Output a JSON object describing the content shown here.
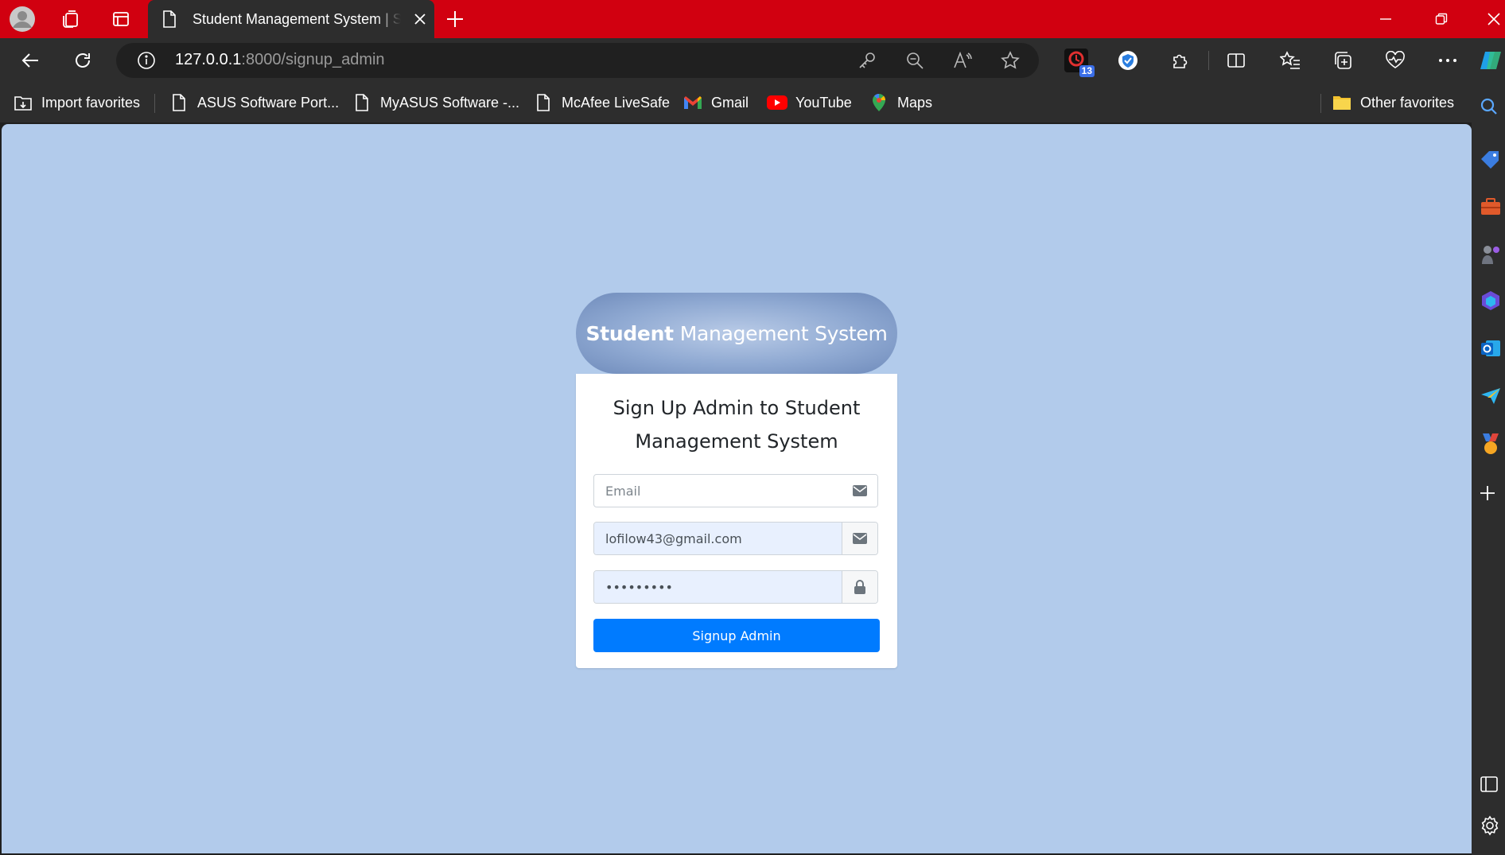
{
  "browser": {
    "tab": {
      "title": "Student Management System | Si"
    },
    "address": {
      "host": "127.0.0.1",
      "rest": ":8000/signup_admin"
    },
    "extension_badge": "13",
    "favorites": [
      {
        "label": "Import favorites",
        "icon": "import-icon"
      },
      {
        "label": "ASUS Software Port...",
        "icon": "page-icon"
      },
      {
        "label": "MyASUS Software -...",
        "icon": "page-icon"
      },
      {
        "label": "McAfee LiveSafe",
        "icon": "page-icon"
      },
      {
        "label": "Gmail",
        "icon": "gmail-icon"
      },
      {
        "label": "YouTube",
        "icon": "youtube-icon"
      },
      {
        "label": "Maps",
        "icon": "maps-icon"
      }
    ],
    "other_favorites": "Other favorites",
    "colors": {
      "titlebar": "#D10010",
      "toolbar": "#2D2D2D"
    }
  },
  "page": {
    "brand_bold": "Student",
    "brand_rest": "Management System",
    "heading": "Sign Up Admin to Student Management System",
    "email_placeholder": "Email",
    "email_value": "lofilow43@gmail.com",
    "password_value": "•••••••••",
    "submit_label": "Signup Admin",
    "colors": {
      "background": "#B2CBEB",
      "button": "#007BFF",
      "autofill": "#E8F0FE"
    }
  }
}
